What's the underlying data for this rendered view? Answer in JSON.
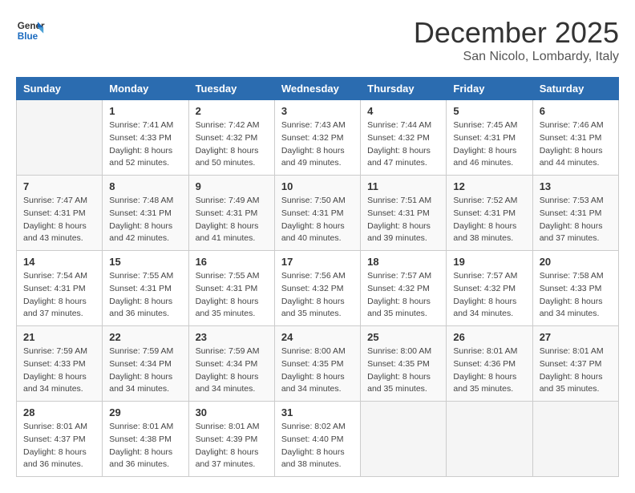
{
  "header": {
    "logo_line1": "General",
    "logo_line2": "Blue",
    "month": "December 2025",
    "location": "San Nicolo, Lombardy, Italy"
  },
  "weekdays": [
    "Sunday",
    "Monday",
    "Tuesday",
    "Wednesday",
    "Thursday",
    "Friday",
    "Saturday"
  ],
  "weeks": [
    [
      {
        "day": "",
        "info": ""
      },
      {
        "day": "1",
        "info": "Sunrise: 7:41 AM\nSunset: 4:33 PM\nDaylight: 8 hours\nand 52 minutes."
      },
      {
        "day": "2",
        "info": "Sunrise: 7:42 AM\nSunset: 4:32 PM\nDaylight: 8 hours\nand 50 minutes."
      },
      {
        "day": "3",
        "info": "Sunrise: 7:43 AM\nSunset: 4:32 PM\nDaylight: 8 hours\nand 49 minutes."
      },
      {
        "day": "4",
        "info": "Sunrise: 7:44 AM\nSunset: 4:32 PM\nDaylight: 8 hours\nand 47 minutes."
      },
      {
        "day": "5",
        "info": "Sunrise: 7:45 AM\nSunset: 4:31 PM\nDaylight: 8 hours\nand 46 minutes."
      },
      {
        "day": "6",
        "info": "Sunrise: 7:46 AM\nSunset: 4:31 PM\nDaylight: 8 hours\nand 44 minutes."
      }
    ],
    [
      {
        "day": "7",
        "info": "Sunrise: 7:47 AM\nSunset: 4:31 PM\nDaylight: 8 hours\nand 43 minutes."
      },
      {
        "day": "8",
        "info": "Sunrise: 7:48 AM\nSunset: 4:31 PM\nDaylight: 8 hours\nand 42 minutes."
      },
      {
        "day": "9",
        "info": "Sunrise: 7:49 AM\nSunset: 4:31 PM\nDaylight: 8 hours\nand 41 minutes."
      },
      {
        "day": "10",
        "info": "Sunrise: 7:50 AM\nSunset: 4:31 PM\nDaylight: 8 hours\nand 40 minutes."
      },
      {
        "day": "11",
        "info": "Sunrise: 7:51 AM\nSunset: 4:31 PM\nDaylight: 8 hours\nand 39 minutes."
      },
      {
        "day": "12",
        "info": "Sunrise: 7:52 AM\nSunset: 4:31 PM\nDaylight: 8 hours\nand 38 minutes."
      },
      {
        "day": "13",
        "info": "Sunrise: 7:53 AM\nSunset: 4:31 PM\nDaylight: 8 hours\nand 37 minutes."
      }
    ],
    [
      {
        "day": "14",
        "info": "Sunrise: 7:54 AM\nSunset: 4:31 PM\nDaylight: 8 hours\nand 37 minutes."
      },
      {
        "day": "15",
        "info": "Sunrise: 7:55 AM\nSunset: 4:31 PM\nDaylight: 8 hours\nand 36 minutes."
      },
      {
        "day": "16",
        "info": "Sunrise: 7:55 AM\nSunset: 4:31 PM\nDaylight: 8 hours\nand 35 minutes."
      },
      {
        "day": "17",
        "info": "Sunrise: 7:56 AM\nSunset: 4:32 PM\nDaylight: 8 hours\nand 35 minutes."
      },
      {
        "day": "18",
        "info": "Sunrise: 7:57 AM\nSunset: 4:32 PM\nDaylight: 8 hours\nand 35 minutes."
      },
      {
        "day": "19",
        "info": "Sunrise: 7:57 AM\nSunset: 4:32 PM\nDaylight: 8 hours\nand 34 minutes."
      },
      {
        "day": "20",
        "info": "Sunrise: 7:58 AM\nSunset: 4:33 PM\nDaylight: 8 hours\nand 34 minutes."
      }
    ],
    [
      {
        "day": "21",
        "info": "Sunrise: 7:59 AM\nSunset: 4:33 PM\nDaylight: 8 hours\nand 34 minutes."
      },
      {
        "day": "22",
        "info": "Sunrise: 7:59 AM\nSunset: 4:34 PM\nDaylight: 8 hours\nand 34 minutes."
      },
      {
        "day": "23",
        "info": "Sunrise: 7:59 AM\nSunset: 4:34 PM\nDaylight: 8 hours\nand 34 minutes."
      },
      {
        "day": "24",
        "info": "Sunrise: 8:00 AM\nSunset: 4:35 PM\nDaylight: 8 hours\nand 34 minutes."
      },
      {
        "day": "25",
        "info": "Sunrise: 8:00 AM\nSunset: 4:35 PM\nDaylight: 8 hours\nand 35 minutes."
      },
      {
        "day": "26",
        "info": "Sunrise: 8:01 AM\nSunset: 4:36 PM\nDaylight: 8 hours\nand 35 minutes."
      },
      {
        "day": "27",
        "info": "Sunrise: 8:01 AM\nSunset: 4:37 PM\nDaylight: 8 hours\nand 35 minutes."
      }
    ],
    [
      {
        "day": "28",
        "info": "Sunrise: 8:01 AM\nSunset: 4:37 PM\nDaylight: 8 hours\nand 36 minutes."
      },
      {
        "day": "29",
        "info": "Sunrise: 8:01 AM\nSunset: 4:38 PM\nDaylight: 8 hours\nand 36 minutes."
      },
      {
        "day": "30",
        "info": "Sunrise: 8:01 AM\nSunset: 4:39 PM\nDaylight: 8 hours\nand 37 minutes."
      },
      {
        "day": "31",
        "info": "Sunrise: 8:02 AM\nSunset: 4:40 PM\nDaylight: 8 hours\nand 38 minutes."
      },
      {
        "day": "",
        "info": ""
      },
      {
        "day": "",
        "info": ""
      },
      {
        "day": "",
        "info": ""
      }
    ]
  ]
}
